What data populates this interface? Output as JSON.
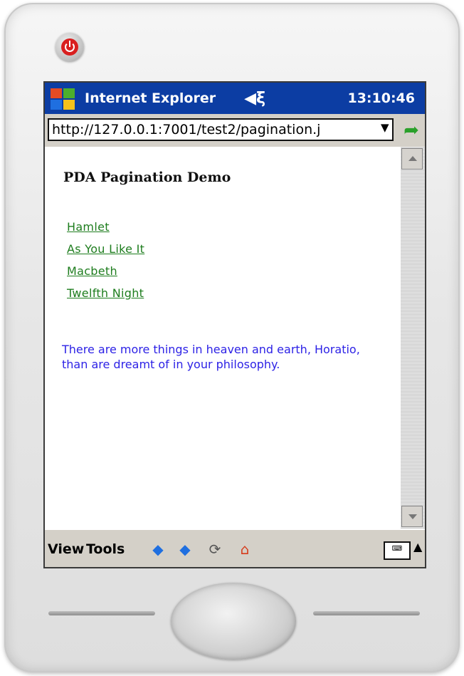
{
  "window": {
    "app_title": "Internet Explorer",
    "clock": "13:10:46"
  },
  "address": {
    "url": "http://127.0.0.1:7001/test2/pagination.j"
  },
  "page": {
    "heading": "PDA Pagination Demo",
    "links": [
      "Hamlet",
      "As You Like It",
      "Macbeth",
      "Twelfth Night"
    ],
    "quote": "There are more things in heaven and earth, Horatio, than are dreamt of in your philosophy."
  },
  "menubar": {
    "view": "View",
    "tools": "Tools"
  },
  "icons": {
    "start": "windows-flag-icon",
    "speaker": "speaker-icon",
    "go": "go-arrow-icon",
    "back": "back-arrow-icon",
    "forward": "forward-arrow-icon",
    "refresh": "refresh-icon",
    "home": "home-icon",
    "keyboard": "keyboard-icon",
    "power": "power-icon"
  },
  "colors": {
    "titlebar": "#0c3da3",
    "link": "#1e7d1e",
    "quote": "#2d22e6",
    "chrome": "#d4d0c8"
  }
}
